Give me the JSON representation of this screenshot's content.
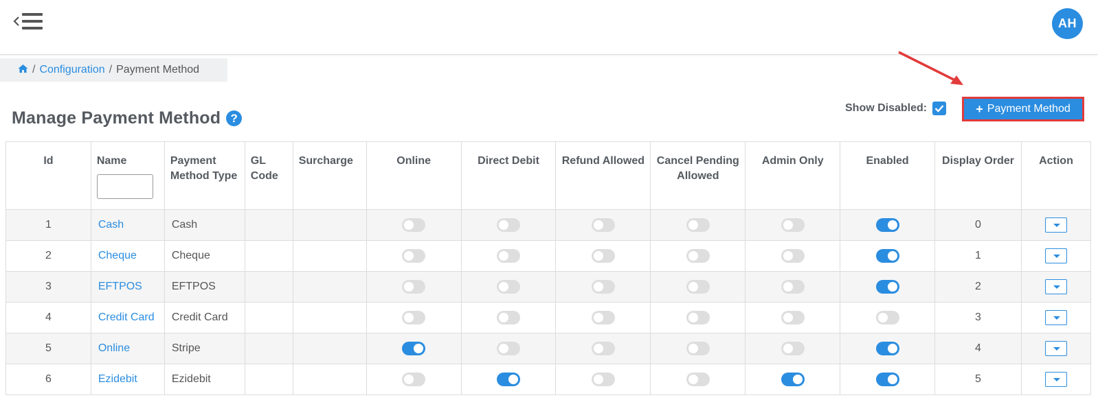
{
  "header": {
    "avatar_initials": "AH",
    "icons": {
      "menu": "menu-collapse-icon",
      "home": "home-icon",
      "help": "question-circle-icon",
      "plus": "plus-icon",
      "caret": "caret-down-icon"
    }
  },
  "breadcrumb": {
    "separator": "/",
    "items": [
      "Configuration",
      "Payment Method"
    ]
  },
  "page": {
    "title": "Manage Payment Method",
    "help_glyph": "?",
    "show_disabled_label": "Show Disabled:",
    "show_disabled_checked": true,
    "add_button_label": "Payment Method",
    "add_button_glyph": "+"
  },
  "colors": {
    "accent": "#2b8de0",
    "highlight": "#e23b3b"
  },
  "table": {
    "columns": [
      "Id",
      "Name",
      "Payment Method Type",
      "GL Code",
      "Surcharge",
      "Online",
      "Direct Debit",
      "Refund Allowed",
      "Cancel Pending Allowed",
      "Admin Only",
      "Enabled",
      "Display Order",
      "Action"
    ],
    "rows": [
      {
        "id": "1",
        "name": "Cash",
        "type": "Cash",
        "gl_code": "",
        "surcharge": "",
        "online": false,
        "direct_debit": false,
        "refund_allowed": false,
        "cancel_pending_allowed": false,
        "admin_only": false,
        "enabled": true,
        "display_order": "0"
      },
      {
        "id": "2",
        "name": "Cheque",
        "type": "Cheque",
        "gl_code": "",
        "surcharge": "",
        "online": false,
        "direct_debit": false,
        "refund_allowed": false,
        "cancel_pending_allowed": false,
        "admin_only": false,
        "enabled": true,
        "display_order": "1"
      },
      {
        "id": "3",
        "name": "EFTPOS",
        "type": "EFTPOS",
        "gl_code": "",
        "surcharge": "",
        "online": false,
        "direct_debit": false,
        "refund_allowed": false,
        "cancel_pending_allowed": false,
        "admin_only": false,
        "enabled": true,
        "display_order": "2"
      },
      {
        "id": "4",
        "name": "Credit Card",
        "type": "Credit Card",
        "gl_code": "",
        "surcharge": "",
        "online": false,
        "direct_debit": false,
        "refund_allowed": false,
        "cancel_pending_allowed": false,
        "admin_only": false,
        "enabled": false,
        "display_order": "3"
      },
      {
        "id": "5",
        "name": "Online",
        "type": "Stripe",
        "gl_code": "",
        "surcharge": "",
        "online": true,
        "direct_debit": false,
        "refund_allowed": false,
        "cancel_pending_allowed": false,
        "admin_only": false,
        "enabled": true,
        "display_order": "4"
      },
      {
        "id": "6",
        "name": "Ezidebit",
        "type": "Ezidebit",
        "gl_code": "",
        "surcharge": "",
        "online": false,
        "direct_debit": true,
        "refund_allowed": false,
        "cancel_pending_allowed": false,
        "admin_only": true,
        "enabled": true,
        "display_order": "5"
      }
    ]
  }
}
